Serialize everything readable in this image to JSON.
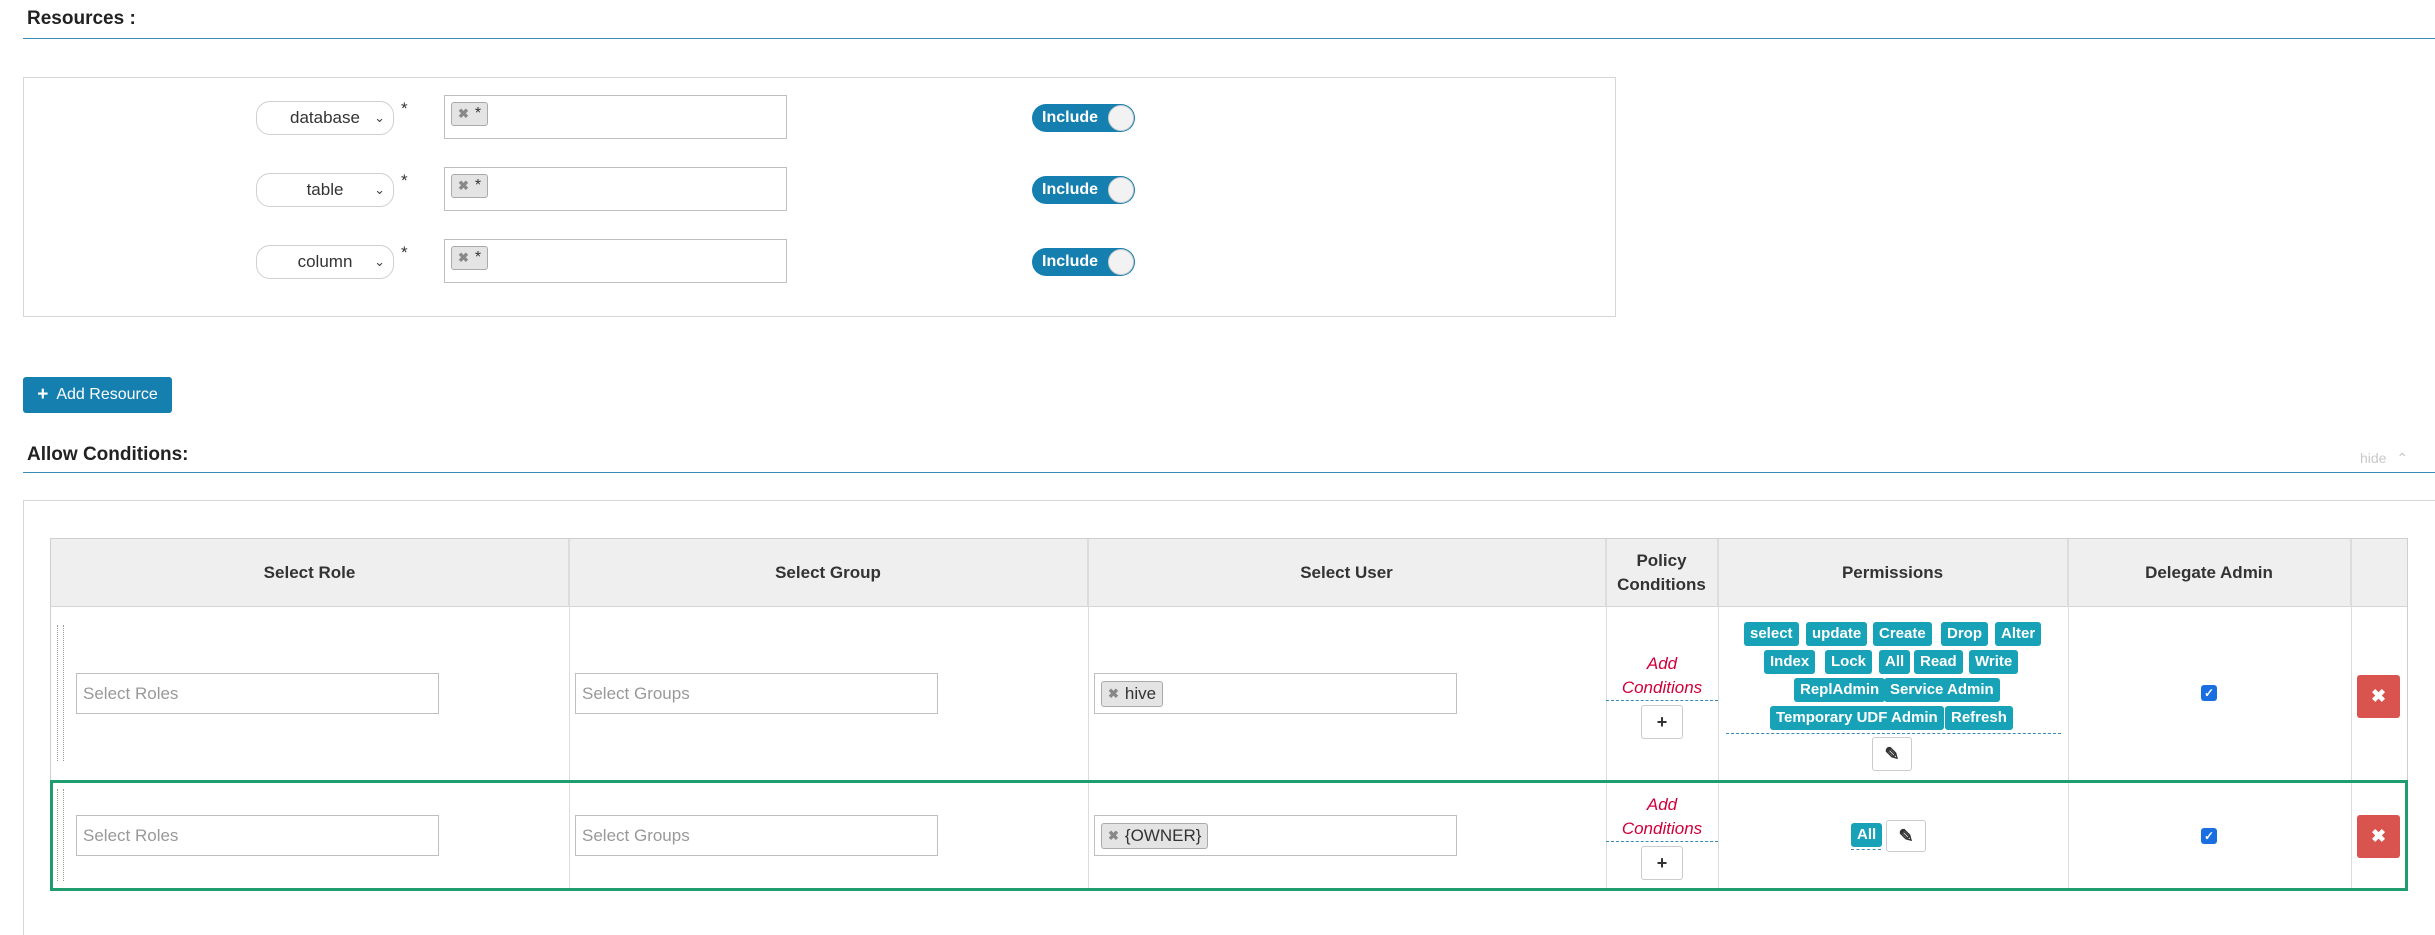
{
  "resources": {
    "title": "Resources :",
    "rows": [
      {
        "type": "database",
        "required_mark": "*",
        "value": "*",
        "toggle": "Include"
      },
      {
        "type": "table",
        "required_mark": "*",
        "value": "*",
        "toggle": "Include"
      },
      {
        "type": "column",
        "required_mark": "*",
        "value": "*",
        "toggle": "Include"
      }
    ],
    "add_button": "Add Resource"
  },
  "allow": {
    "title": "Allow Conditions:",
    "hide_label": "hide",
    "headers": {
      "role": "Select Role",
      "group": "Select Group",
      "user": "Select User",
      "policy_line1": "Policy",
      "policy_line2": "Conditions",
      "permissions": "Permissions",
      "delegate": "Delegate Admin"
    },
    "rows": [
      {
        "role_placeholder": "Select Roles",
        "group_placeholder": "Select Groups",
        "user_tag": "hive",
        "add_cond_line1": "Add",
        "add_cond_line2": "Conditions",
        "permissions": [
          "select",
          "update",
          "Create",
          "Drop",
          "Alter",
          "Index",
          "Lock",
          "All",
          "Read",
          "Write",
          "ReplAdmin",
          "Service Admin",
          "Temporary UDF Admin",
          "Refresh"
        ],
        "delegate_checked": true
      },
      {
        "role_placeholder": "Select Roles",
        "group_placeholder": "Select Groups",
        "user_tag": "{OWNER}",
        "add_cond_line1": "Add",
        "add_cond_line2": "Conditions",
        "permissions": [
          "All"
        ],
        "delegate_checked": true
      }
    ]
  },
  "colors": {
    "accent": "#1580b0",
    "permission": "#17a2b8",
    "danger": "#d9534f",
    "required_condition": "#d0003a",
    "highlight": "#1f9d6f"
  }
}
